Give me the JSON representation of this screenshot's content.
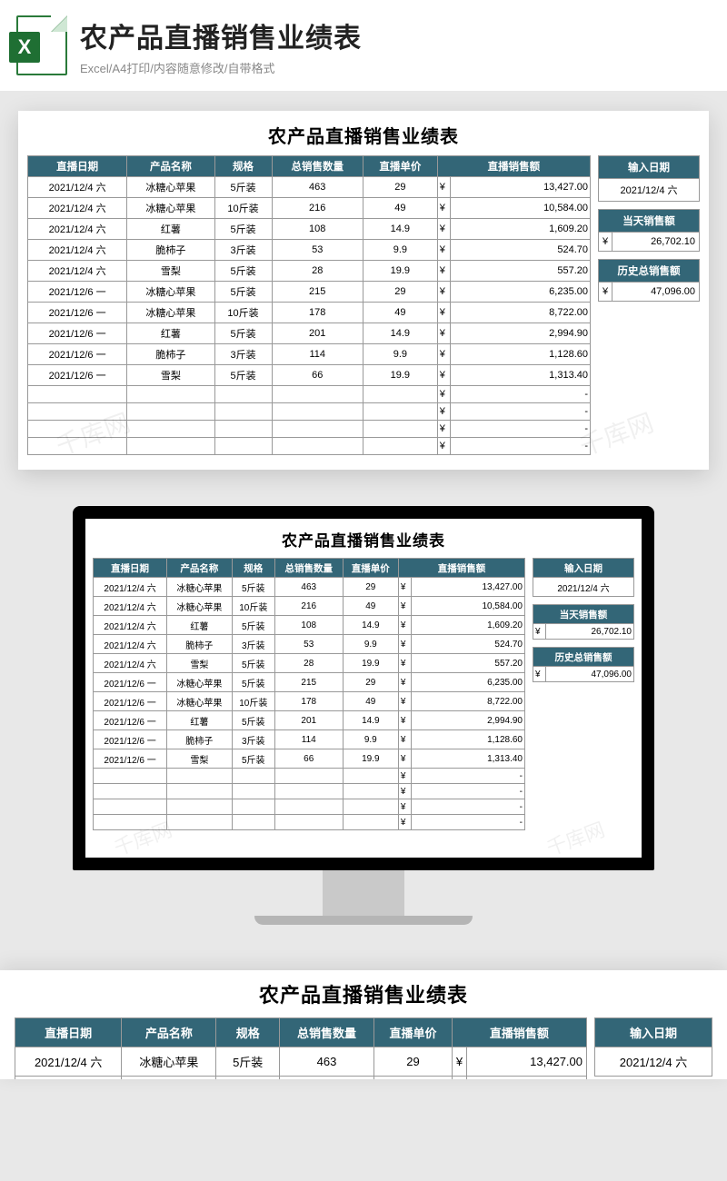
{
  "banner": {
    "title": "农产品直播销售业绩表",
    "subtitle": "Excel/A4打印/内容随意修改/自带格式",
    "icon_letter": "X"
  },
  "sheet": {
    "title": "农产品直播销售业绩表",
    "currency": "¥",
    "dash": "-",
    "columns": {
      "date": "直播日期",
      "product": "产品名称",
      "spec": "规格",
      "qty": "总销售数量",
      "price": "直播单价",
      "sales": "直播销售额"
    },
    "rows": [
      {
        "date": "2021/12/4 六",
        "product": "冰糖心苹果",
        "spec": "5斤装",
        "qty": "463",
        "price": "29",
        "sales": "13,427.00"
      },
      {
        "date": "2021/12/4 六",
        "product": "冰糖心苹果",
        "spec": "10斤装",
        "qty": "216",
        "price": "49",
        "sales": "10,584.00"
      },
      {
        "date": "2021/12/4 六",
        "product": "红薯",
        "spec": "5斤装",
        "qty": "108",
        "price": "14.9",
        "sales": "1,609.20"
      },
      {
        "date": "2021/12/4 六",
        "product": "脆柿子",
        "spec": "3斤装",
        "qty": "53",
        "price": "9.9",
        "sales": "524.70"
      },
      {
        "date": "2021/12/4 六",
        "product": "雪梨",
        "spec": "5斤装",
        "qty": "28",
        "price": "19.9",
        "sales": "557.20"
      },
      {
        "date": "2021/12/6 一",
        "product": "冰糖心苹果",
        "spec": "5斤装",
        "qty": "215",
        "price": "29",
        "sales": "6,235.00"
      },
      {
        "date": "2021/12/6 一",
        "product": "冰糖心苹果",
        "spec": "10斤装",
        "qty": "178",
        "price": "49",
        "sales": "8,722.00"
      },
      {
        "date": "2021/12/6 一",
        "product": "红薯",
        "spec": "5斤装",
        "qty": "201",
        "price": "14.9",
        "sales": "2,994.90"
      },
      {
        "date": "2021/12/6 一",
        "product": "脆柿子",
        "spec": "3斤装",
        "qty": "114",
        "price": "9.9",
        "sales": "1,128.60"
      },
      {
        "date": "2021/12/6 一",
        "product": "雪梨",
        "spec": "5斤装",
        "qty": "66",
        "price": "19.9",
        "sales": "1,313.40"
      }
    ],
    "empty_rows": 4
  },
  "side": {
    "input_date_label": "输入日期",
    "input_date_value": "2021/12/4 六",
    "day_sales_label": "当天销售额",
    "day_sales_value": "26,702.10",
    "total_sales_label": "历史总销售额",
    "total_sales_value": "47,096.00"
  },
  "watermark": "千库网"
}
